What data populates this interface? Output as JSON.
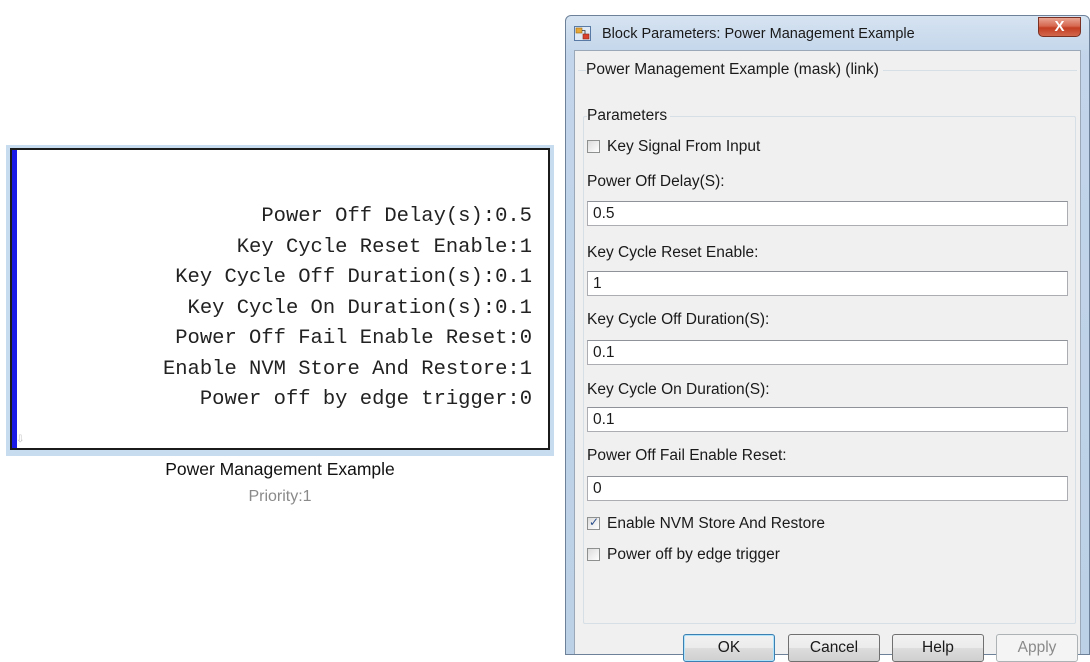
{
  "block": {
    "lines": [
      "Power Off Delay(s):0.5",
      "Key Cycle Reset Enable:1",
      "Key Cycle Off Duration(s):0.1",
      "Key Cycle On Duration(s):0.1",
      "Power Off Fail Enable Reset:0",
      "Enable NVM Store And Restore:1",
      "Power off by edge trigger:0"
    ],
    "name": "Power Management Example",
    "priority": "Priority:1"
  },
  "dialog": {
    "title": "Block Parameters: Power Management Example",
    "close_glyph": "X",
    "mask_label": "Power Management Example (mask) (link)",
    "parameters_label": "Parameters",
    "key_signal": {
      "label": "Key Signal From Input",
      "checked": false
    },
    "power_off_delay": {
      "label": "Power Off Delay(S):",
      "value": "0.5"
    },
    "key_cycle_reset": {
      "label": "Key Cycle Reset Enable:",
      "value": "1"
    },
    "key_cycle_off": {
      "label": "Key Cycle Off Duration(S):",
      "value": "0.1"
    },
    "key_cycle_on": {
      "label": "Key Cycle On Duration(S):",
      "value": "0.1"
    },
    "power_off_fail": {
      "label": "Power Off Fail Enable Reset:",
      "value": "0"
    },
    "enable_nvm": {
      "label": "Enable NVM Store And Restore",
      "checked": true,
      "check_glyph": "✓"
    },
    "edge_trigger": {
      "label": "Power off by edge trigger",
      "checked": false
    },
    "buttons": {
      "ok": "OK",
      "cancel": "Cancel",
      "help": "Help",
      "apply": "Apply"
    }
  },
  "colors": {
    "block_port": "#1a1ae6",
    "block_selection": "#c8dcef",
    "close_button": "#c33e23"
  }
}
